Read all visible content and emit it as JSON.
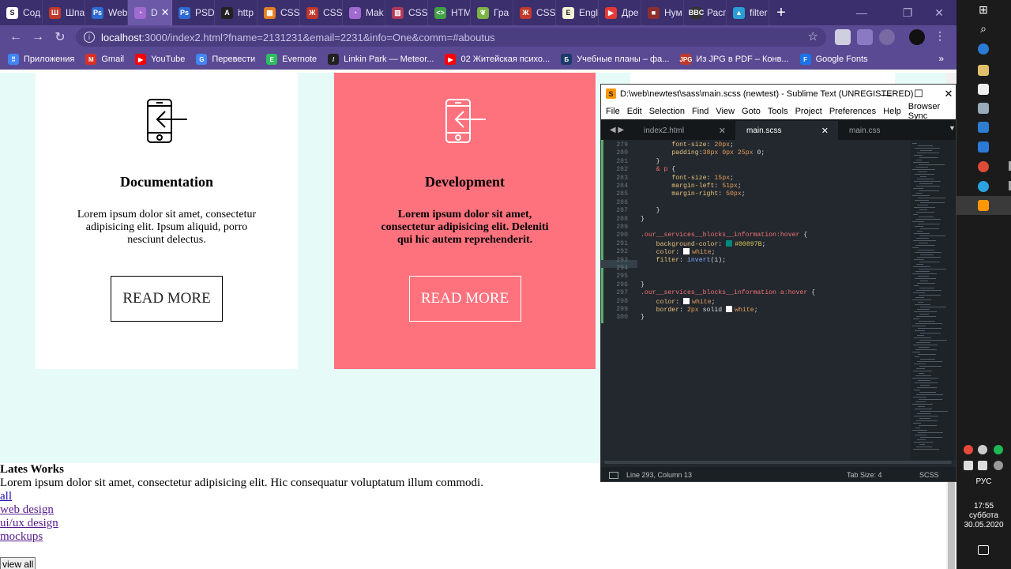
{
  "browser": {
    "tabs": [
      {
        "label": "Сод",
        "color": "#ffffff",
        "glyph": "S"
      },
      {
        "label": "Шпа",
        "color": "#c0392b",
        "glyph": "Ш"
      },
      {
        "label": "Web",
        "color": "#2e6ad1",
        "glyph": "Ps"
      },
      {
        "label": "D",
        "color": "#a06ad1",
        "glyph": "◔",
        "active": true
      },
      {
        "label": "PSD",
        "color": "#2e6ad1",
        "glyph": "Ps"
      },
      {
        "label": "http",
        "color": "#222222",
        "glyph": "A"
      },
      {
        "label": "CSS",
        "color": "#e67e22",
        "glyph": "▦"
      },
      {
        "label": "CSS",
        "color": "#c0392b",
        "glyph": "Ж"
      },
      {
        "label": "Mak",
        "color": "#a06ad1",
        "glyph": "◔"
      },
      {
        "label": "CSS",
        "color": "#b03a5b",
        "glyph": "▥"
      },
      {
        "label": "HTM",
        "color": "#43a047",
        "glyph": "<>"
      },
      {
        "label": "Гра",
        "color": "#7cb342",
        "glyph": "❦"
      },
      {
        "label": "CSS",
        "color": "#c0392b",
        "glyph": "Ж"
      },
      {
        "label": "Engl",
        "color": "#f5f5dc",
        "glyph": "E"
      },
      {
        "label": "Дре",
        "color": "#e53935",
        "glyph": "▶"
      },
      {
        "label": "Нум",
        "color": "#8d2e2e",
        "glyph": "■"
      },
      {
        "label": "Расп",
        "color": "#333333",
        "glyph": "BBC"
      },
      {
        "label": "filter",
        "color": "#2a9fd6",
        "glyph": "▲"
      }
    ],
    "new_tab": "+",
    "window_controls": {
      "minimize": "—",
      "restore": "❐",
      "close": "✕"
    },
    "nav": {
      "back": "←",
      "forward": "→",
      "reload": "↻",
      "info": "i",
      "star": "☆"
    },
    "url_host": "localhost",
    "url_path": ":3000/index2.html?fname=2131231&email=2231&info=One&comm=#aboutus",
    "bookmarks": [
      {
        "label": "Приложения",
        "color": "#4285f4",
        "glyph": "⠿"
      },
      {
        "label": "Gmail",
        "color": "#d93025",
        "glyph": "M"
      },
      {
        "label": "YouTube",
        "color": "#ff0000",
        "glyph": "▶"
      },
      {
        "label": "Перевести",
        "color": "#4285f4",
        "glyph": "G"
      },
      {
        "label": "Evernote",
        "color": "#2dbe60",
        "glyph": "E"
      },
      {
        "label": "Linkin Park — Meteor...",
        "color": "#222222",
        "glyph": "/"
      },
      {
        "label": "02 Житейская психо...",
        "color": "#ff0000",
        "glyph": "▶"
      },
      {
        "label": "Учебные планы – фа...",
        "color": "#1b3a6b",
        "glyph": "Б"
      },
      {
        "label": "Из JPG в PDF – Конв...",
        "color": "#c0392b",
        "glyph": "JPG"
      },
      {
        "label": "Google Fonts",
        "color": "#1a73e8",
        "glyph": "F"
      }
    ],
    "bookmarks_more": "»"
  },
  "page": {
    "cards": [
      {
        "title": "Documentation",
        "text": "Lorem ipsum dolor sit amet, consectetur adipisicing elit. Ipsum aliquid, porro nesciunt delectus.",
        "button": "READ MORE"
      },
      {
        "title": "Development",
        "text": "Lorem ipsum dolor sit amet, consectetur adipisicing elit. Deleniti qui hic autem reprehenderit.",
        "button": "READ MORE"
      }
    ],
    "card_colors": {
      "page_bg": "#e6fbf8",
      "card_accent": "#fe727e"
    },
    "works": {
      "title": "Lates Works",
      "text": "Lorem ipsum dolor sit amet, consectetur adipisicing elit. Hic consequatur voluptatum illum commodi.",
      "links": [
        "all",
        "web design",
        "ui/ux design",
        "mockups"
      ],
      "view_all": "view all"
    }
  },
  "sublime": {
    "title": "D:\\web\\newtest\\sass\\main.scss (newtest) - Sublime Text (UNREGISTERED)",
    "menu": [
      "File",
      "Edit",
      "Selection",
      "Find",
      "View",
      "Goto",
      "Tools",
      "Project",
      "Preferences",
      "Help",
      "Browser Sync"
    ],
    "tabs": [
      {
        "label": "index2.html",
        "active": false
      },
      {
        "label": "main.scss",
        "active": true
      },
      {
        "label": "main.css",
        "active": false
      }
    ],
    "tab_close": "✕",
    "tab_nav": "◀ ▶",
    "tab_dropdown": "▼",
    "lines": [
      {
        "n": "279",
        "code": "        font-size: 20px;"
      },
      {
        "n": "280",
        "code": "        padding:38px 0px 25px 0;"
      },
      {
        "n": "281",
        "code": "    }"
      },
      {
        "n": "282",
        "code": "    & p {"
      },
      {
        "n": "283",
        "code": "        font-size: 15px;"
      },
      {
        "n": "284",
        "code": "        margin-left: 51px;"
      },
      {
        "n": "285",
        "code": "        margin-right: 50px;"
      },
      {
        "n": "286",
        "code": ""
      },
      {
        "n": "287",
        "code": "    }"
      },
      {
        "n": "288",
        "code": "}"
      },
      {
        "n": "289",
        "code": ""
      },
      {
        "n": "290",
        "code": ".our__services__blocks__information:hover {"
      },
      {
        "n": "291",
        "code": "    background-color: ■ #00897B;"
      },
      {
        "n": "292",
        "code": "    color: □ white;"
      },
      {
        "n": "293",
        "code": "    filter: invert(1);"
      },
      {
        "n": "294",
        "code": ""
      },
      {
        "n": "295",
        "code": ""
      },
      {
        "n": "296",
        "code": "}"
      },
      {
        "n": "297",
        "code": ".our__services__blocks__information a:hover {"
      },
      {
        "n": "298",
        "code": "    color: □ white;"
      },
      {
        "n": "299",
        "code": "    border: 2px solid □ white;"
      },
      {
        "n": "300",
        "code": "}"
      }
    ],
    "status": {
      "position": "Line 293, Column 13",
      "tab_size": "Tab Size: 4",
      "syntax": "SCSS"
    },
    "colors": {
      "teal": "#00897B",
      "white": "#ffffff"
    }
  },
  "taskbar": {
    "language": "РУС",
    "time": "17:55",
    "day": "суббота",
    "date": "30.05.2020"
  }
}
